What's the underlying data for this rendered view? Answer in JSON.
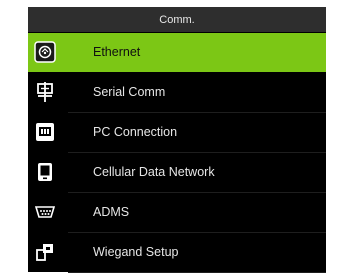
{
  "title": "Comm.",
  "accent_color": "#7cc715",
  "menu": {
    "selected_index": 0,
    "items": [
      {
        "label": "Ethernet",
        "icon": "ethernet-icon"
      },
      {
        "label": "Serial Comm",
        "icon": "serial-comm-icon"
      },
      {
        "label": "PC Connection",
        "icon": "pc-connection-icon"
      },
      {
        "label": "Cellular Data Network",
        "icon": "cellular-data-icon"
      },
      {
        "label": "ADMS",
        "icon": "adms-icon"
      },
      {
        "label": "Wiegand Setup",
        "icon": "wiegand-icon"
      }
    ]
  }
}
